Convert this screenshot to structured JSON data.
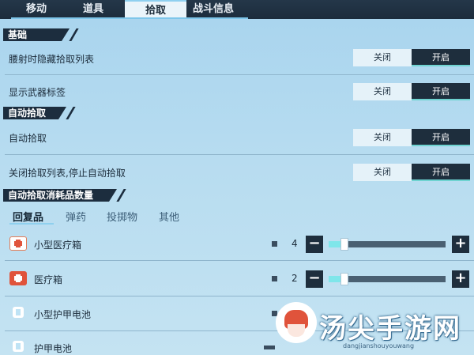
{
  "tabs": [
    {
      "label": "移动"
    },
    {
      "label": "道具"
    },
    {
      "label": "拾取"
    },
    {
      "label": "战斗信息"
    }
  ],
  "active_tab": "拾取",
  "sections": {
    "basic": "基础",
    "auto_pickup": "自动拾取",
    "consumables": "自动拾取消耗品数量"
  },
  "settings": [
    {
      "label": "腰射时隐藏拾取列表",
      "off": "关闭",
      "on": "开启",
      "state": "on"
    },
    {
      "label": "显示武器标签",
      "off": "关闭",
      "on": "开启",
      "state": "on"
    },
    {
      "label": "自动拾取",
      "off": "关闭",
      "on": "开启",
      "state": "on"
    },
    {
      "label": "关闭拾取列表,停止自动拾取",
      "off": "关闭",
      "on": "开启",
      "state": "on"
    }
  ],
  "subtabs": [
    {
      "label": "回复品"
    },
    {
      "label": "弹药"
    },
    {
      "label": "投掷物"
    },
    {
      "label": "其他"
    }
  ],
  "items": [
    {
      "label": "小型医疗箱",
      "count": "4",
      "icon": "small-medkit-icon"
    },
    {
      "label": "医疗箱",
      "count": "2",
      "icon": "medkit-icon"
    },
    {
      "label": "小型护甲电池",
      "icon": "small-armor-battery-icon"
    },
    {
      "label": "护甲电池",
      "icon": "armor-battery-icon"
    }
  ],
  "watermark": {
    "text": "汤尖手游网",
    "sub": "dangjianshouyouwang"
  },
  "colors": {
    "accent": "#7fe6ea",
    "dark": "#1e2e3d",
    "background": "#b7dcf0"
  }
}
